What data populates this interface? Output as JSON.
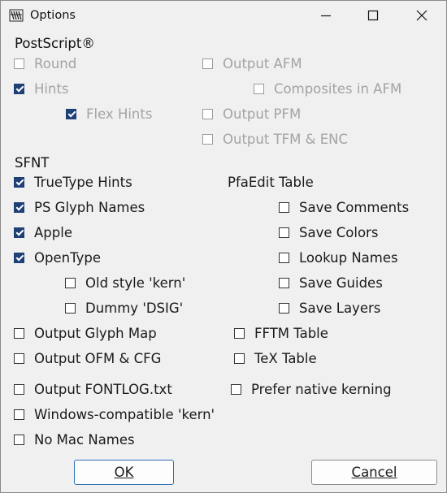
{
  "window": {
    "title": "Options",
    "app_icon": "fontforge-icon"
  },
  "window_controls": {
    "minimize": "minimize-icon",
    "maximize": "maximize-icon",
    "close": "close-icon"
  },
  "postscript": {
    "header": "PostScript®",
    "round": {
      "label": "Round",
      "checked": false,
      "enabled": false
    },
    "hints": {
      "label": "Hints",
      "checked": true,
      "enabled": false
    },
    "flex_hints": {
      "label": "Flex Hints",
      "checked": true,
      "enabled": false
    },
    "output_afm": {
      "label": "Output AFM",
      "checked": false,
      "enabled": false
    },
    "composites_in_afm": {
      "label": "Composites in AFM",
      "checked": false,
      "enabled": false
    },
    "output_pfm": {
      "label": "Output PFM",
      "checked": false,
      "enabled": false
    },
    "output_tfm_enc": {
      "label": "Output TFM & ENC",
      "checked": false,
      "enabled": false
    }
  },
  "sfnt": {
    "header": "SFNT",
    "truetype_hints": {
      "label": "TrueType Hints",
      "checked": true
    },
    "ps_glyph_names": {
      "label": "PS Glyph Names",
      "checked": true
    },
    "apple": {
      "label": "Apple",
      "checked": true
    },
    "opentype": {
      "label": "OpenType",
      "checked": true
    },
    "old_style_kern": {
      "label": "Old style 'kern'",
      "checked": false
    },
    "dummy_dsig": {
      "label": "Dummy 'DSIG'",
      "checked": false
    },
    "output_glyph_map": {
      "label": "Output Glyph Map",
      "checked": false
    },
    "output_ofm_cfg": {
      "label": "Output OFM & CFG",
      "checked": false
    },
    "output_fontlog": {
      "label": "Output FONTLOG.txt",
      "checked": false
    },
    "windows_kern": {
      "label": "Windows-compatible 'kern'",
      "checked": false
    },
    "no_mac_names": {
      "label": "No Mac Names",
      "checked": false
    }
  },
  "pfaedit": {
    "header": "PfaEdit Table",
    "save_comments": {
      "label": "Save Comments",
      "checked": false
    },
    "save_colors": {
      "label": "Save Colors",
      "checked": false
    },
    "lookup_names": {
      "label": "Lookup Names",
      "checked": false
    },
    "save_guides": {
      "label": "Save Guides",
      "checked": false
    },
    "save_layers": {
      "label": "Save Layers",
      "checked": false
    }
  },
  "other": {
    "fftm_table": {
      "label": "FFTM Table",
      "checked": false
    },
    "tex_table": {
      "label": "TeX Table",
      "checked": false
    },
    "prefer_native_kerning": {
      "label": "Prefer native kerning",
      "checked": false
    }
  },
  "buttons": {
    "ok": "OK",
    "cancel": "Cancel"
  }
}
